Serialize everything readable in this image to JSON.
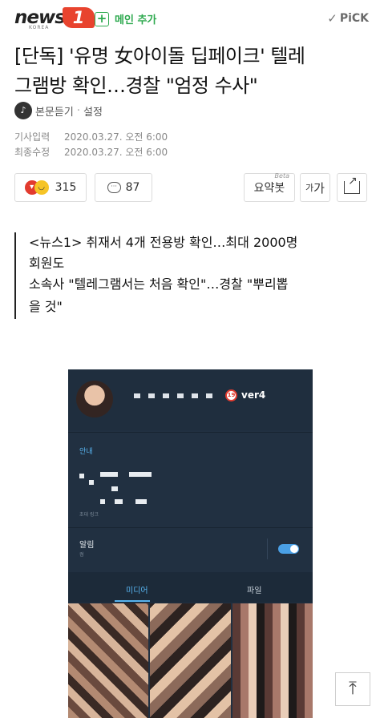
{
  "header": {
    "logo_word": "news",
    "logo_number": "1",
    "logo_sub": "KOREA",
    "main_add_label": "메인 추가",
    "pick_label": "PiCK"
  },
  "article": {
    "headline_line1": "[단독] '유명 女아이돌 딥페이크' 텔레",
    "headline_line2": "그램방 확인…경찰 \"엄정 수사\"",
    "tts_label": "본문듣기",
    "settings_label": "설정",
    "input_label": "기사입력",
    "input_date": "2020.03.27. 오전 6:00",
    "modified_label": "최종수정",
    "modified_date": "2020.03.27. 오전 6:00",
    "quote_line1": "<뉴스1> 취재서 4개 전용방 확인…최대 2000명",
    "quote_line1b": "회원도",
    "quote_line2": "소속사 \"텔레그램서는 처음 확인\"…경찰 \"뿌리뽑",
    "quote_line2b": "을 것\""
  },
  "toolbar": {
    "reaction_count": "315",
    "comment_count": "87",
    "summary_label": "요약봇",
    "summary_beta": "Beta",
    "font_small": "가",
    "font_large": "가"
  },
  "embedded_screenshot": {
    "version": "ver4",
    "age_badge": "19",
    "section_label": "안내",
    "small_caption": "초대 링크",
    "alarm_label": "알림",
    "alarm_sub": "켬",
    "tab_media": "미디어",
    "tab_file": "파일"
  },
  "scroll_top_icon": "arrow-up-icon"
}
